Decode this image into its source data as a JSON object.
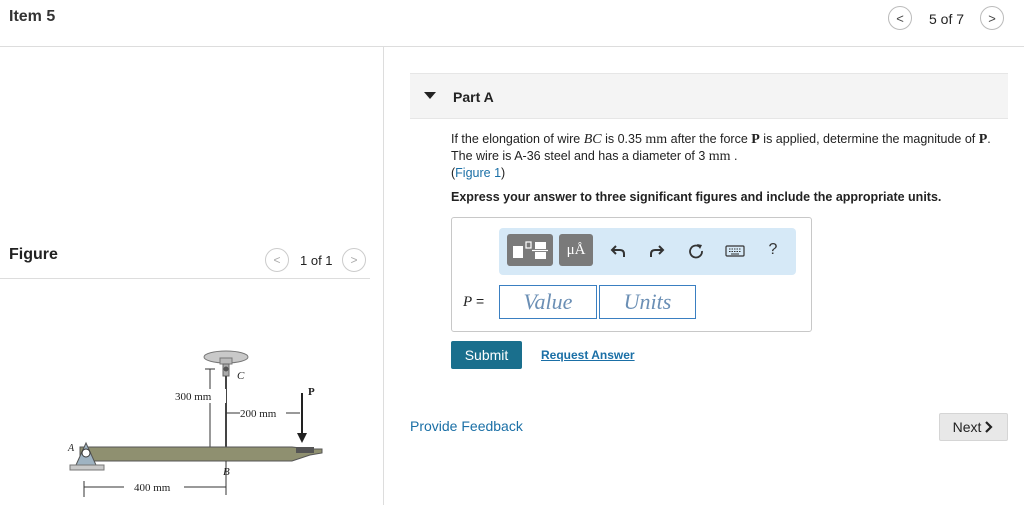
{
  "header": {
    "item_title": "Item 5",
    "pager_text": "5 of 7",
    "prev_glyph": "<",
    "next_glyph": ">"
  },
  "figure_panel": {
    "label": "Figure",
    "pager_text": "1 of 1",
    "prev_glyph": "<",
    "next_glyph": ">",
    "diagram": {
      "dim_300": "300 mm",
      "dim_200": "200 mm",
      "dim_400": "400 mm",
      "label_c": "C",
      "label_b": "B",
      "label_a": "A",
      "label_p": "P"
    }
  },
  "part": {
    "title": "Part A",
    "q_pre": "If the elongation of wire ",
    "q_var": "BC",
    "q_mid1": " is 0.35 ",
    "q_unit1": "mm",
    "q_mid2": " after the force ",
    "q_force": "P",
    "q_mid3": " is applied, determine the magnitude of ",
    "q_force2": "P",
    "q_mid4": ". The wire is A-36 steel and has a diameter of 3 ",
    "q_unit2": "mm",
    "q_end": " .",
    "figure_link_open": "(",
    "figure_link": "Figure 1",
    "figure_link_close": ")",
    "instruction": "Express your answer to three significant figures and include the appropriate units."
  },
  "answer": {
    "toolbar": {
      "units_glyph": "μÅ",
      "help_glyph": "?",
      "icons": [
        "templates-icon",
        "units-icon",
        "undo-icon",
        "redo-icon",
        "reset-icon",
        "keyboard-icon",
        "help-icon"
      ]
    },
    "var_label": "P",
    "eq": " =",
    "value_placeholder": "Value",
    "units_placeholder": "Units"
  },
  "actions": {
    "submit": "Submit",
    "request_answer": "Request Answer",
    "feedback": "Provide Feedback",
    "next": "Next"
  },
  "colors": {
    "link": "#1a6fa6",
    "submit_bg": "#1a6f8d",
    "toolbar_bg": "#d6e9f7",
    "input_border": "#3a7fc1"
  }
}
